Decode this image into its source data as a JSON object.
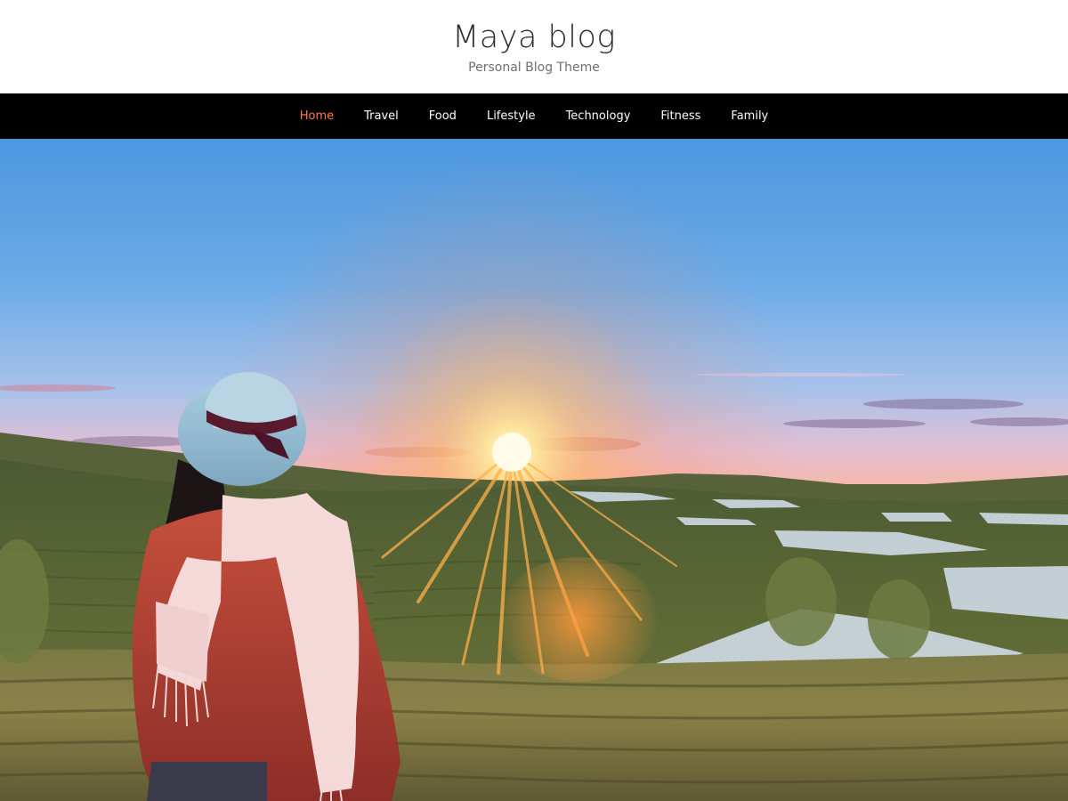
{
  "site": {
    "title": "Maya blog",
    "tagline": "Personal Blog Theme"
  },
  "nav": {
    "items": [
      {
        "label": "Home",
        "active": true
      },
      {
        "label": "Travel",
        "active": false
      },
      {
        "label": "Food",
        "active": false
      },
      {
        "label": "Lifestyle",
        "active": false
      },
      {
        "label": "Technology",
        "active": false
      },
      {
        "label": "Fitness",
        "active": false
      },
      {
        "label": "Family",
        "active": false
      }
    ]
  },
  "colors": {
    "nav_background": "#000000",
    "nav_text": "#ffffff",
    "nav_active": "#ff7b4a",
    "title_text": "#2b2b2b",
    "tagline_text": "#6f6f6f"
  },
  "hero": {
    "image_subject": "woman-in-hat-watching-sunset-over-tea-fields"
  }
}
